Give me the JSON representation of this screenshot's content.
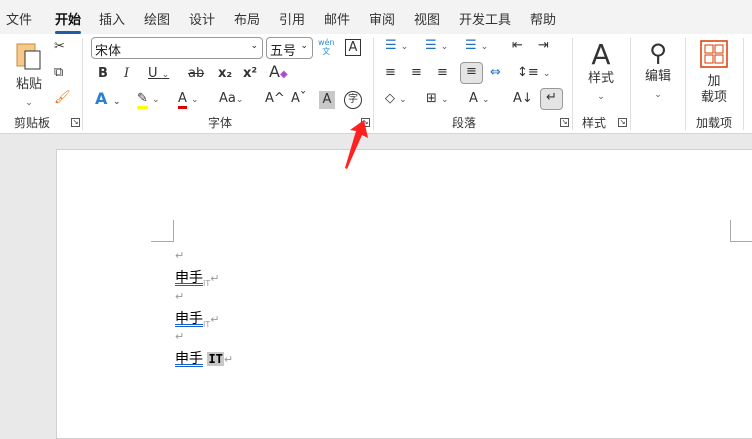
{
  "tabs": [
    "文件",
    "开始",
    "插入",
    "绘图",
    "设计",
    "布局",
    "引用",
    "邮件",
    "审阅",
    "视图",
    "开发工具",
    "帮助"
  ],
  "active_tab": "开始",
  "clipboard": {
    "paste": "粘贴",
    "group": "剪贴板"
  },
  "font": {
    "name": "宋体",
    "size": "五号",
    "group": "字体",
    "phonetic": "wén\n文",
    "bold": "B",
    "italic": "I",
    "underline": "U",
    "strike": "ab",
    "sub": "x₂",
    "sup": "x²",
    "text_effect": "A",
    "font_color": "A",
    "change_case": "Aa",
    "grow": "A^",
    "shrink": "Aˇ",
    "shading": "A",
    "enclose": "字",
    "border": "A"
  },
  "paragraph": {
    "group": "段落"
  },
  "styles": {
    "label": "样式",
    "group": "样式"
  },
  "editing": {
    "label": "编辑"
  },
  "addins": {
    "label": "加\n载项",
    "group": "加载项"
  },
  "colors": {
    "accent": "#1f5ea8",
    "highlight": "#ffff00",
    "font_color": "#e00000",
    "addin": "#d83b01",
    "arrow": "#ff2020"
  },
  "document": {
    "lines": [
      {
        "text": "申手",
        "suffix": "IT"
      },
      {
        "text": "申手",
        "suffix": "IT"
      },
      {
        "text": "申手",
        "suffix": "IT",
        "selected": true
      }
    ],
    "para_mark": "↵"
  }
}
